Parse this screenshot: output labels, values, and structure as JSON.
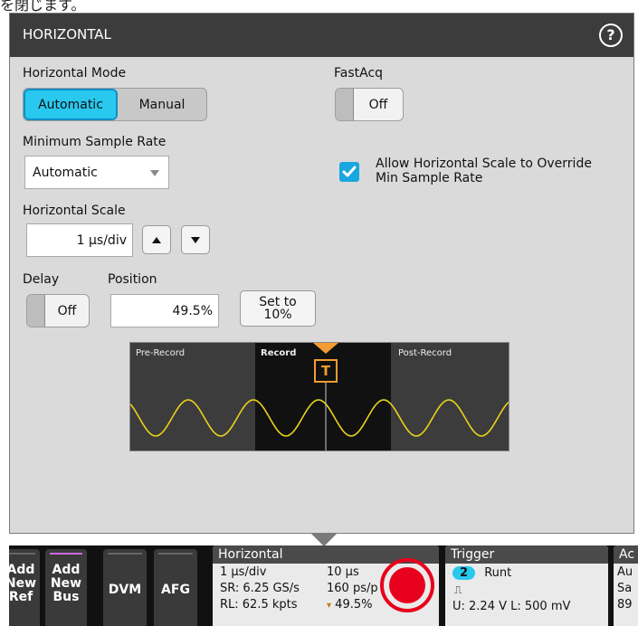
{
  "top_text": "を閉じます。",
  "panel": {
    "title": "HORIZONTAL",
    "help_label": "?",
    "horizontal_mode": {
      "label": "Horizontal Mode",
      "options": [
        "Automatic",
        "Manual"
      ],
      "selected": "Automatic"
    },
    "fastacq": {
      "label": "FastAcq",
      "value": "Off"
    },
    "min_sample_rate": {
      "label": "Minimum Sample Rate",
      "value": "Automatic"
    },
    "allow_override": {
      "line1": "Allow Horizontal Scale to Override",
      "line2": "Min Sample Rate",
      "checked": true
    },
    "horizontal_scale": {
      "label": "Horizontal Scale",
      "value": "1 µs/div"
    },
    "delay": {
      "label": "Delay",
      "value": "Off"
    },
    "position": {
      "label": "Position",
      "value": "49.5%",
      "set_line1": "Set to",
      "set_line2": "10%"
    },
    "diagram": {
      "pre_record": "Pre-Record",
      "record": "Record",
      "post_record": "Post-Record",
      "trigger_marker": "T"
    }
  },
  "bottom_bar": {
    "add_ref": [
      "Add",
      "New",
      "Ref"
    ],
    "add_bus": [
      "Add",
      "New",
      "Bus"
    ],
    "dvm": "DVM",
    "afg": "AFG",
    "horizontal": {
      "title": "Horizontal",
      "scale": "1 µs/div",
      "time": "10 µs",
      "sr": "SR: 6.25 GS/s",
      "ps": "160 ps/p",
      "rl": "RL: 62.5 kpts",
      "pos": "49.5%"
    },
    "trigger": {
      "title": "Trigger",
      "channel": "2",
      "type": "Runt",
      "levels": "U: 2.24 V  L: 500 mV"
    },
    "acq": {
      "title": "Ac",
      "line1": "Au",
      "line2": "Sa",
      "line3": "89"
    }
  },
  "colors": {
    "accent": "#29c8ee",
    "waveform": "#e8d21a",
    "trigger_marker": "#f39c32",
    "record_indicator": "#e8001c"
  }
}
